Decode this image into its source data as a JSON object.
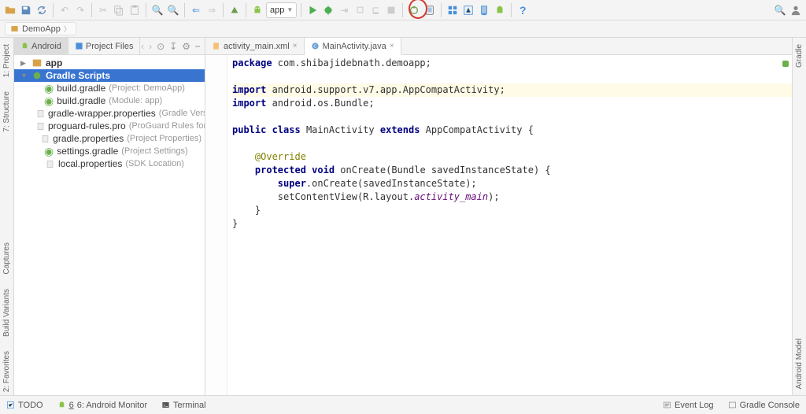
{
  "toolbar": {
    "app_select": "app"
  },
  "breadcrumb": {
    "app": "DemoApp"
  },
  "project_tabs": {
    "android": "Android",
    "files": "Project Files"
  },
  "tree": {
    "app": "app",
    "gradle_scripts": "Gradle Scripts",
    "items": [
      {
        "name": "build.gradle",
        "hint": "(Project: DemoApp)"
      },
      {
        "name": "build.gradle",
        "hint": "(Module: app)"
      },
      {
        "name": "gradle-wrapper.properties",
        "hint": "(Gradle Version)"
      },
      {
        "name": "proguard-rules.pro",
        "hint": "(ProGuard Rules for app)"
      },
      {
        "name": "gradle.properties",
        "hint": "(Project Properties)"
      },
      {
        "name": "settings.gradle",
        "hint": "(Project Settings)"
      },
      {
        "name": "local.properties",
        "hint": "(SDK Location)"
      }
    ]
  },
  "editor_tabs": {
    "t0": "activity_main.xml",
    "t1": "MainActivity.java"
  },
  "code": {
    "pkg_kw": "package",
    "pkg": " com.shibajidebnath.demoapp;",
    "imp_kw": "import",
    "imp1": " android.support.v7.app.AppCompatActivity;",
    "imp2": " android.os.Bundle;",
    "pub": "public",
    "cls": "class",
    "main": " MainActivity ",
    "ext": "extends",
    "parent": " AppCompatActivity {",
    "ann": "@Override",
    "prot": "protected",
    "void": "void",
    "oncreate": " onCreate(Bundle savedInstanceState) {",
    "super_kw": "super",
    "super_rest": ".onCreate(savedInstanceState);",
    "setc": "setContentView(R.layout.",
    "amain": "activity_main",
    "cparen": ");",
    "cb1": "    }",
    "cb2": "}"
  },
  "left_rail": {
    "project": "1: Project",
    "structure": "7: Structure",
    "captures": "Captures",
    "build": "Build Variants",
    "fav": "2: Favorites"
  },
  "right_rail": {
    "gradle": "Gradle",
    "model": "Android Model"
  },
  "status": {
    "todo": "TODO",
    "android_mon": "6: Android Monitor",
    "terminal": "Terminal",
    "eventlog": "Event Log",
    "gradle_console": "Gradle Console"
  }
}
